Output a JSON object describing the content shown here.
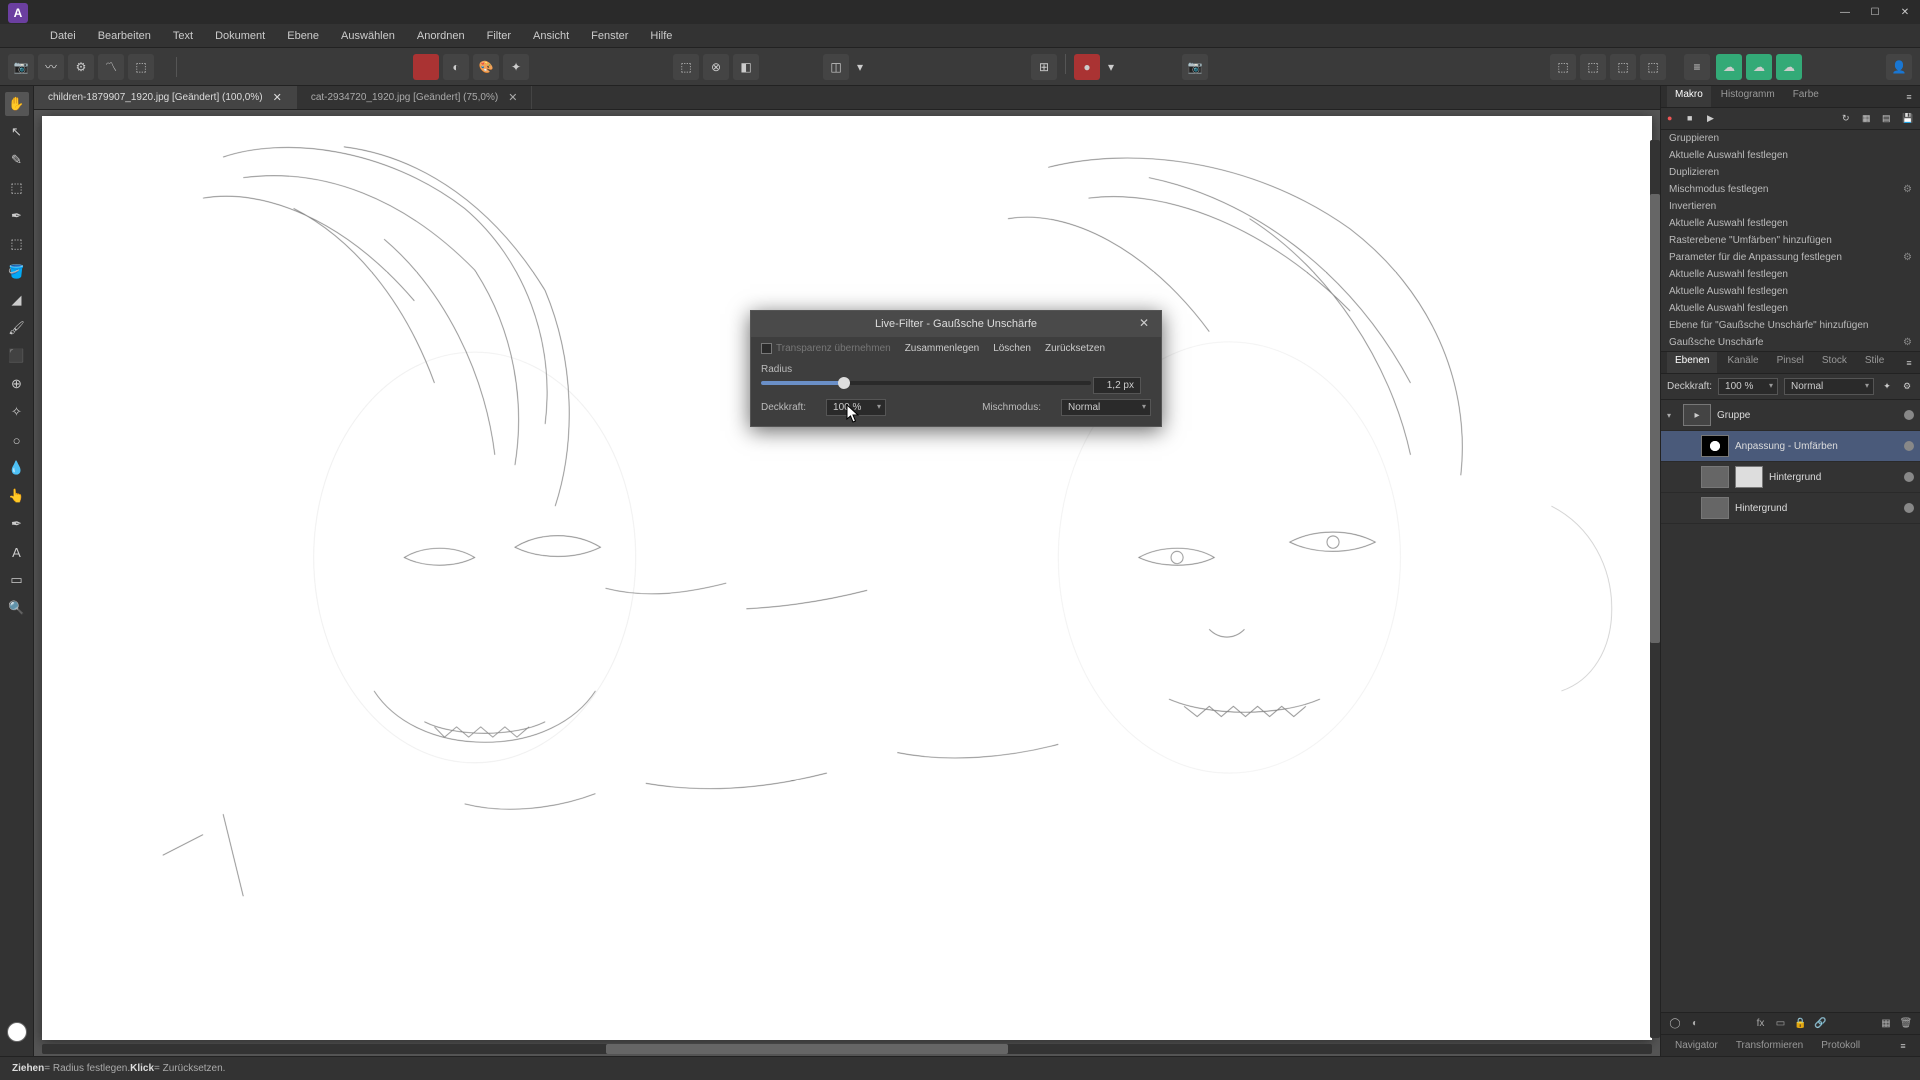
{
  "app": {
    "logo_letter": "A"
  },
  "win": {
    "min": "—",
    "max": "☐",
    "close": "✕"
  },
  "menu": [
    "Datei",
    "Bearbeiten",
    "Text",
    "Dokument",
    "Ebene",
    "Auswählen",
    "Anordnen",
    "Filter",
    "Ansicht",
    "Fenster",
    "Hilfe"
  ],
  "tabs": [
    {
      "label": "children-1879907_1920.jpg [Geändert] (100,0%)",
      "active": true
    },
    {
      "label": "cat-2934720_1920.jpg [Geändert] (75,0%)",
      "active": false
    }
  ],
  "dialog": {
    "title": "Live-Filter - Gaußsche Unschärfe",
    "transparenz": "Transparenz übernehmen",
    "buttons": [
      "Zusammenlegen",
      "Löschen",
      "Zurücksetzen"
    ],
    "radius_label": "Radius",
    "radius_value": "1,2 px",
    "deckkraft_label": "Deckkraft:",
    "deckkraft_value": "100 %",
    "mischmodus_label": "Mischmodus:",
    "mischmodus_value": "Normal"
  },
  "panels": {
    "top_tabs": [
      "Makro",
      "Histogramm",
      "Farbe"
    ],
    "macro_items": [
      {
        "label": "Gruppieren",
        "gear": false
      },
      {
        "label": "Aktuelle Auswahl festlegen",
        "gear": false
      },
      {
        "label": "Duplizieren",
        "gear": false
      },
      {
        "label": "Mischmodus festlegen",
        "gear": true
      },
      {
        "label": "Invertieren",
        "gear": false
      },
      {
        "label": "Aktuelle Auswahl festlegen",
        "gear": false
      },
      {
        "label": "Rasterebene \"Umfärben\" hinzufügen",
        "gear": false
      },
      {
        "label": "Parameter für die Anpassung festlegen",
        "gear": true
      },
      {
        "label": "Aktuelle Auswahl festlegen",
        "gear": false
      },
      {
        "label": "Aktuelle Auswahl festlegen",
        "gear": false
      },
      {
        "label": "Aktuelle Auswahl festlegen",
        "gear": false
      },
      {
        "label": "Ebene für \"Gaußsche Unschärfe\" hinzufügen",
        "gear": false
      },
      {
        "label": "Gaußsche Unschärfe",
        "gear": true
      }
    ],
    "layer_tabs": [
      "Ebenen",
      "Kanäle",
      "Pinsel",
      "Stock",
      "Stile"
    ],
    "layer_opts": {
      "deckkraft_label": "Deckkraft:",
      "deckkraft": "100 %",
      "blend": "Normal"
    },
    "layers": [
      {
        "name": "Gruppe",
        "type": "group",
        "selected": false,
        "indent": 0
      },
      {
        "name": "Anpassung - Umfärben",
        "type": "adjust",
        "selected": true,
        "indent": 1
      },
      {
        "name": "Hintergrund",
        "type": "pixel",
        "selected": false,
        "indent": 1,
        "mask": true
      },
      {
        "name": "Hintergrund",
        "type": "pixel",
        "selected": false,
        "indent": 1
      }
    ],
    "bottom_tabs": [
      "Navigator",
      "Transformieren",
      "Protokoll"
    ]
  },
  "status": {
    "drag_label": "Ziehen",
    "drag_text": " = Radius festlegen. ",
    "click_label": "Klick",
    "click_text": " = Zurücksetzen."
  }
}
